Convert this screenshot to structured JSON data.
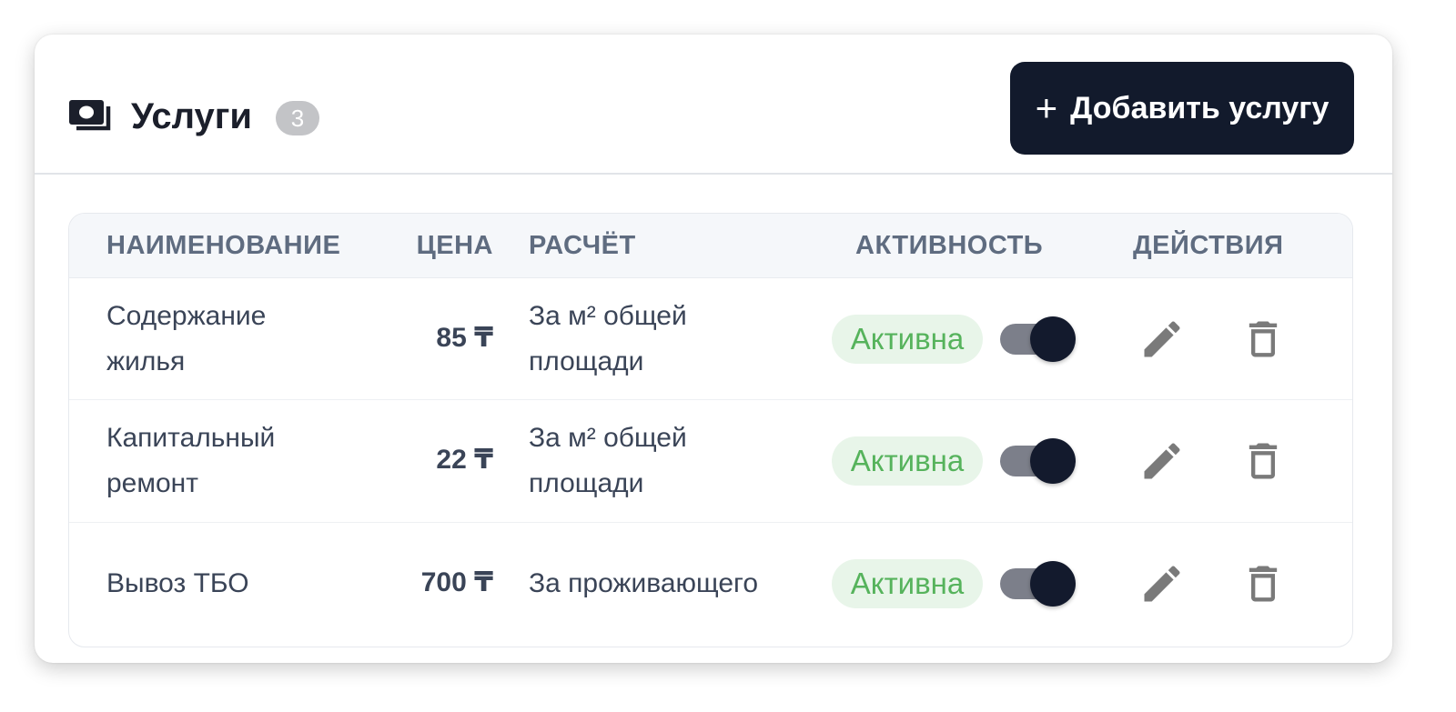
{
  "header": {
    "title": "Услуги",
    "count": "3",
    "icon": "money-icon",
    "add_button": {
      "plus": "+",
      "label": "Добавить услугу"
    }
  },
  "table": {
    "columns": {
      "name": "НАИМЕНОВАНИЕ",
      "price": "ЦЕНА",
      "calc": "РАСЧЁТ",
      "activity": "АКТИВНОСТЬ",
      "actions": "ДЕЙСТВИЯ"
    },
    "rows": [
      {
        "name_line1": "Содержание",
        "name_line2": "жилья",
        "price": "85 ₸",
        "calc_line1": "За м² общей",
        "calc_line2": "площади",
        "status": "Активна",
        "enabled": true
      },
      {
        "name_line1": "Капитальный",
        "name_line2": "ремонт",
        "price": "22 ₸",
        "calc_line1": "За м² общей",
        "calc_line2": "площади",
        "status": "Активна",
        "enabled": true
      },
      {
        "name_line1": "Вывоз ТБО",
        "price": "700 ₸",
        "calc_line1": "За проживающего",
        "status": "Активна",
        "enabled": true
      }
    ]
  },
  "icons": {
    "edit": "pencil-icon",
    "delete": "trash-icon",
    "add": "plus-icon"
  },
  "colors": {
    "primary": "#121a2c",
    "status_bg": "#e8f5e9",
    "status_text": "#56b35c",
    "badge_bg": "#c3c4c7",
    "header_text": "#5f6c80"
  }
}
